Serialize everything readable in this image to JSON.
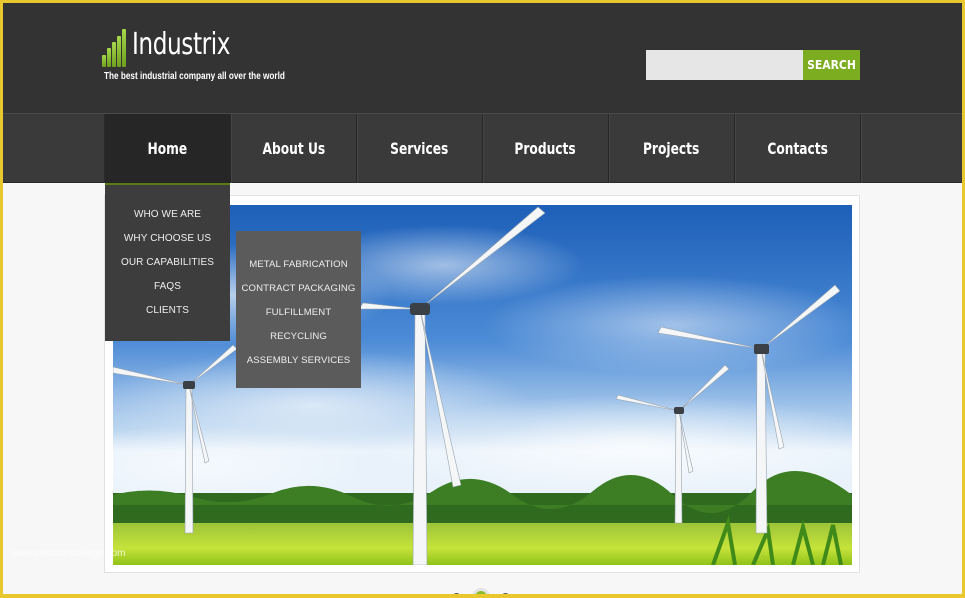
{
  "brand": {
    "name": "Industrix",
    "tagline": "The best industrial company all over the world",
    "accent_color": "#7cac1f"
  },
  "search": {
    "value": "",
    "placeholder": "",
    "button_label": "SEARCH"
  },
  "nav": {
    "items": [
      {
        "label": "Home",
        "active": true
      },
      {
        "label": "About Us",
        "active": false
      },
      {
        "label": "Services",
        "active": false
      },
      {
        "label": "Products",
        "active": false
      },
      {
        "label": "Projects",
        "active": false
      },
      {
        "label": "Contacts",
        "active": false
      }
    ]
  },
  "dropdown": {
    "items": [
      {
        "label": "WHO WE ARE"
      },
      {
        "label": "WHY CHOOSE US"
      },
      {
        "label": "OUR CAPABILITIES"
      },
      {
        "label": "FAQS"
      },
      {
        "label": "CLIENTS"
      }
    ]
  },
  "submenu": {
    "parent": "OUR CAPABILITIES",
    "items": [
      {
        "label": "METAL FABRICATION"
      },
      {
        "label": "CONTRACT PACKAGING"
      },
      {
        "label": "FULFILLMENT"
      },
      {
        "label": "RECYCLING"
      },
      {
        "label": "ASSEMBLY SERVICES"
      }
    ]
  },
  "slider": {
    "image_alt": "Wind turbines on green field under blue cloudy sky",
    "slide_count": 3,
    "active_index": 1
  },
  "watermark": {
    "text": "www.christiancollege.com"
  }
}
